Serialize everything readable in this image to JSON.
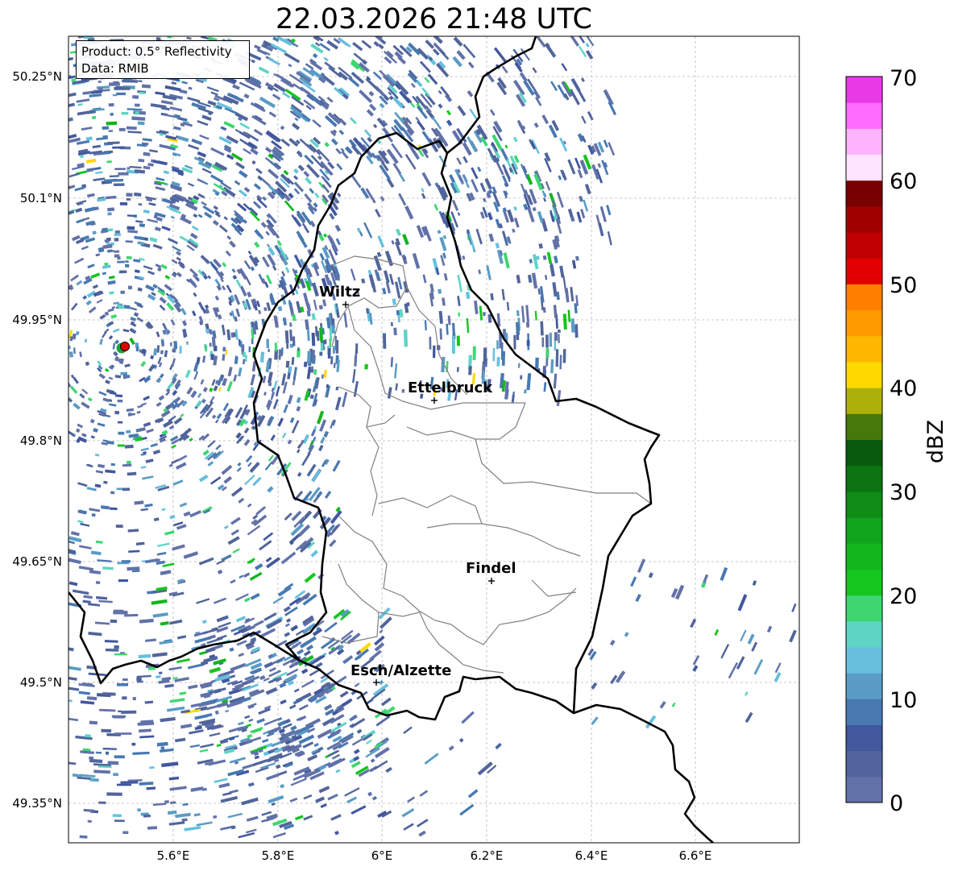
{
  "title": "22.03.2026 21:48 UTC",
  "info": {
    "product": "Product: 0.5° Reflectivity",
    "data_source": "Data: RMIB"
  },
  "axes": {
    "lon_ticks": [
      "5.6°E",
      "5.8°E",
      "6°E",
      "6.2°E",
      "6.4°E",
      "6.6°E"
    ],
    "lat_ticks": [
      "50.25°N",
      "50.1°N",
      "49.95°N",
      "49.8°N",
      "49.65°N",
      "49.5°N",
      "49.35°N"
    ],
    "grid": true
  },
  "cities": [
    {
      "name": "Wiltz"
    },
    {
      "name": "Ettelbruck"
    },
    {
      "name": "Findel"
    },
    {
      "name": "Esch/Alzette"
    }
  ],
  "colorbar": {
    "label": "dBZ",
    "ticks": [
      "0",
      "10",
      "20",
      "30",
      "40",
      "50",
      "60",
      "70"
    ],
    "min": 0,
    "max": 70,
    "step": 2.5,
    "colors": [
      "#6272a8",
      "#51659c",
      "#41579e",
      "#4879b1",
      "#5a9cc5",
      "#66c0dd",
      "#5ed4c5",
      "#3ed671",
      "#14c61e",
      "#12b61c",
      "#10a41a",
      "#0e8c16",
      "#0c7412",
      "#085a0e",
      "#457a0a",
      "#aeb00a",
      "#ffd800",
      "#ffb600",
      "#ff9a00",
      "#ff7e00",
      "#e20000",
      "#c00000",
      "#a00000",
      "#780000",
      "#ffe4ff",
      "#ffb4ff",
      "#ff6cff",
      "#ea3ae8"
    ]
  },
  "radar_site": {
    "color": "#e30000"
  }
}
